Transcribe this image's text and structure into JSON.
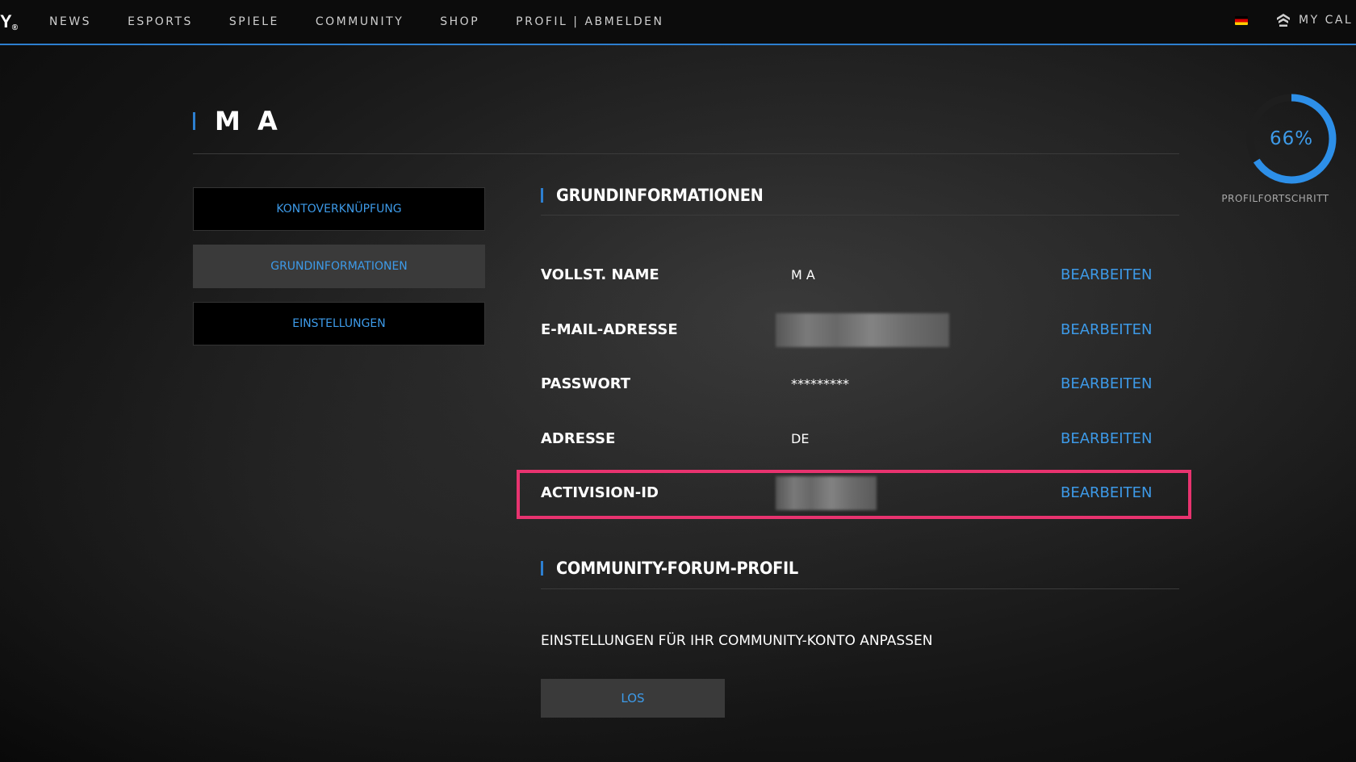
{
  "nav": {
    "logo": "Y",
    "logo_reg": "®",
    "items": [
      "NEWS",
      "ESPORTS",
      "SPIELE",
      "COMMUNITY",
      "SHOP",
      "PROFIL | ABMELDEN"
    ],
    "flag_icon": "german-flag-icon",
    "mycall_icon": "mycall-icon",
    "mycall_label": "MY CAL"
  },
  "profile": {
    "title": "M A",
    "progress_percent": 66,
    "progress_text": "66%",
    "progress_label": "PROFILFORTSCHRITT"
  },
  "sidebar": {
    "items": [
      {
        "label": "KONTOVERKNÜPFUNG",
        "active": false
      },
      {
        "label": "GRUNDINFORMATIONEN",
        "active": true
      },
      {
        "label": "EINSTELLUNGEN",
        "active": false
      }
    ]
  },
  "basic_info": {
    "heading": "GRUNDINFORMATIONEN",
    "edit_label": "BEARBEITEN",
    "rows": [
      {
        "label": "VOLLST. NAME",
        "value": "M A"
      },
      {
        "label": "E-MAIL-ADRESSE",
        "value": ""
      },
      {
        "label": "PASSWORT",
        "value": "*********"
      },
      {
        "label": "ADRESSE",
        "value": "DE"
      },
      {
        "label": "ACTIVISION-ID",
        "value": ""
      }
    ]
  },
  "community": {
    "heading": "COMMUNITY-FORUM-PROFIL",
    "description": "EINSTELLUNGEN FÜR IHR COMMUNITY-KONTO ANPASSEN",
    "button_label": "LOS"
  },
  "colors": {
    "accent": "#3d9ae8",
    "highlight": "#e8336f"
  }
}
